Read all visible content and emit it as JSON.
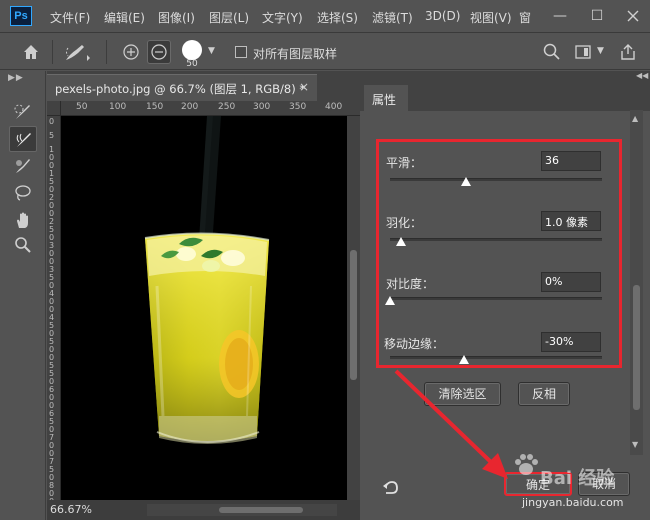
{
  "app": {
    "logo_text": "Ps"
  },
  "menu": {
    "items": [
      "文件(F)",
      "编辑(E)",
      "图像(I)",
      "图层(L)",
      "文字(Y)",
      "选择(S)",
      "滤镜(T)",
      "3D(D)",
      "视图(V)",
      "窗"
    ]
  },
  "window_controls": {
    "minimize": "—",
    "maximize": "☐"
  },
  "options_bar": {
    "brush_size": "50",
    "sample_all_layers_label": "对所有图层取样",
    "sample_all_layers_checked": false
  },
  "document": {
    "tab_title": "pexels-photo.jpg @ 66.7% (图层 1, RGB/8) *",
    "close_label": "×",
    "ruler_h_labels": [
      "50",
      "100",
      "150",
      "200",
      "250",
      "300",
      "350",
      "400"
    ],
    "ruler_v_labels": [
      "0",
      "5",
      "1 0 0",
      "1 5 0",
      "2 0 0",
      "2 5 0",
      "3 0 0",
      "3 5 0",
      "4 0 0",
      "4 5 0",
      "5 0 0",
      "5 5 0",
      "6 0 0",
      "6 5 0",
      "7 0 0",
      "7 5 0",
      "8 0 0"
    ],
    "zoom": "66.67%"
  },
  "properties_panel": {
    "tab_label": "属性",
    "smooth": {
      "label": "平滑：",
      "value": "36",
      "level": 0.36
    },
    "feather": {
      "label": "羽化：",
      "value": "1.0 像素",
      "level": 0.05
    },
    "contrast": {
      "label": "对比度：",
      "value": "0%",
      "level": 0.0
    },
    "shift_edge": {
      "label": "移动边缘：",
      "value": "-30%",
      "level": 0.35
    },
    "clear_selection_label": "清除选区",
    "invert_label": "反相",
    "ok_label": "确定",
    "cancel_label": "取消"
  },
  "watermark": {
    "brand": "Bai 经验",
    "url": "jingyan.baidu.com"
  },
  "colors": {
    "highlight_red": "#e8262f",
    "panel_bg": "#535353",
    "dark_bg": "#424242"
  }
}
